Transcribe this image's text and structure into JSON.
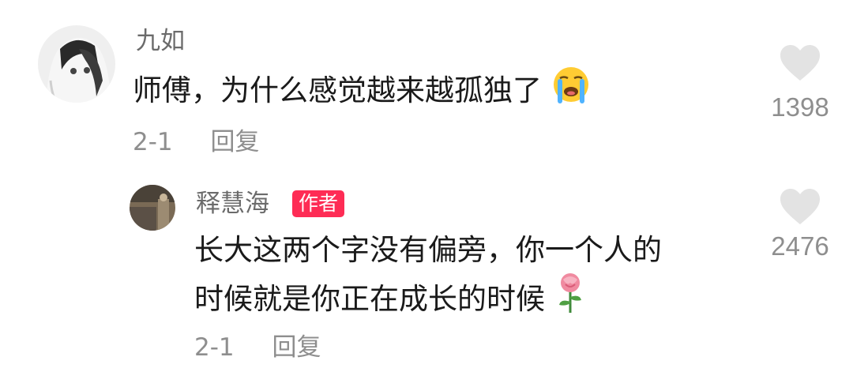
{
  "comment": {
    "username": "九如",
    "text": "师傅，为什么感觉越来越孤独了",
    "emoji": "loudly-crying-face",
    "date": "2-1",
    "reply_label": "回复",
    "likes": "1398"
  },
  "reply": {
    "username": "释慧海",
    "badge": "作者",
    "line1": "长大这两个字没有偏旁，你一个人的",
    "line2": "时候就是你正在成长的时候",
    "emoji": "rose",
    "date": "2-1",
    "reply_label": "回复",
    "likes": "2476"
  },
  "colors": {
    "badge": "#fe2c55",
    "heart": "#e3e3e3",
    "meta": "#8e8e8e"
  }
}
